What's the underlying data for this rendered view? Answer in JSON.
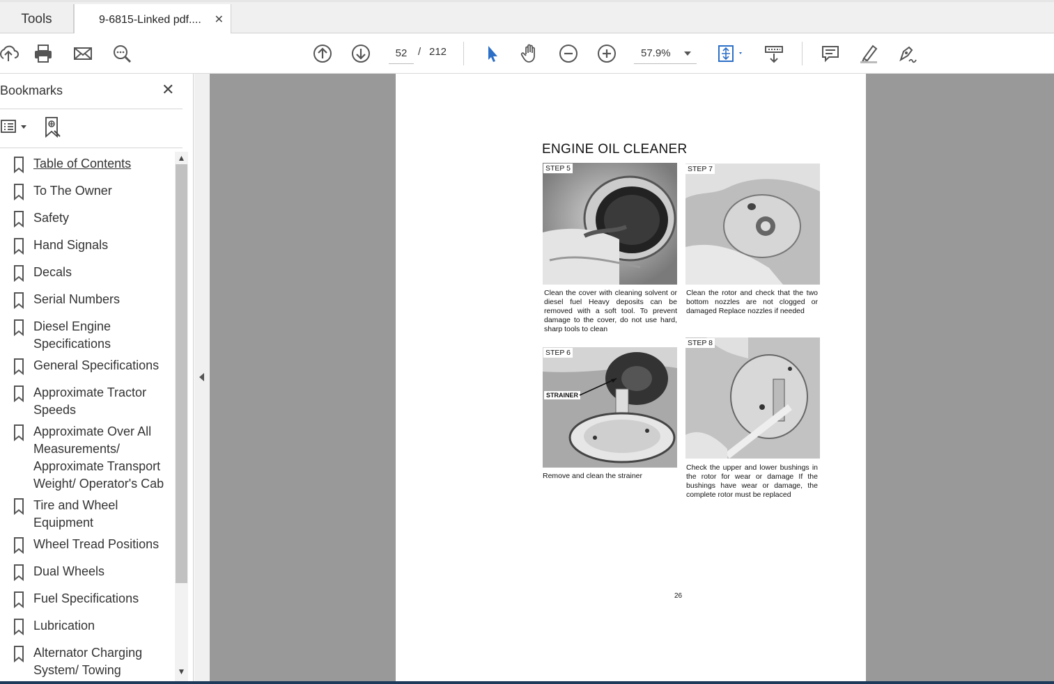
{
  "tabs": {
    "tools_label": "Tools",
    "document_label": "9-6815-Linked pdf....",
    "close_glyph": "✕"
  },
  "toolbar": {
    "icons": [
      "upload-icon",
      "print-icon",
      "email-icon",
      "find-icon",
      "page-up-icon",
      "page-down-icon",
      "select-cursor-icon",
      "hand-tool-icon",
      "zoom-out-icon",
      "zoom-in-icon",
      "fit-page-icon",
      "read-mode-icon",
      "comment-icon",
      "highlight-icon",
      "sign-icon"
    ],
    "current_page": "52",
    "page_separator": "/",
    "total_pages": "212",
    "zoom_value": "57.9%",
    "accent_color": "#2b6fc7"
  },
  "sidebar": {
    "title": "Bookmarks",
    "close_glyph": "✕",
    "scroll_up": "▲",
    "scroll_down": "▼",
    "items": [
      {
        "label": "Table of Contents"
      },
      {
        "label": "To The Owner"
      },
      {
        "label": "Safety"
      },
      {
        "label": "Hand Signals"
      },
      {
        "label": "Decals"
      },
      {
        "label": "Serial Numbers"
      },
      {
        "label": "Diesel Engine Specifications"
      },
      {
        "label": "General Specifications"
      },
      {
        "label": "Approximate Tractor Speeds"
      },
      {
        "label": "Approximate Over All Measurements/ Approximate Transport Weight/ Operator's Cab"
      },
      {
        "label": "Tire and Wheel Equipment"
      },
      {
        "label": "Wheel Tread Positions"
      },
      {
        "label": "Dual Wheels"
      },
      {
        "label": "Fuel Specifications"
      },
      {
        "label": "Lubrication"
      },
      {
        "label": "Alternator Charging System/ Towing"
      }
    ]
  },
  "document": {
    "title": "ENGINE OIL CLEANER",
    "steps": [
      {
        "label": "STEP 5",
        "caption": "Clean the cover with cleaning solvent or diesel fuel Heavy deposits can be removed with a soft tool. To prevent damage to the cover, do not use hard, sharp tools to clean"
      },
      {
        "label": "STEP 7",
        "caption": "Clean the rotor and check that the two bottom nozzles are not clogged or damaged Replace nozzles if needed"
      },
      {
        "label": "STEP 6",
        "caption": "Remove and clean the strainer",
        "callout": "STRAINER"
      },
      {
        "label": "STEP 8",
        "caption": "Check the upper and lower bushings in the rotor for wear or damage If the bushings have wear or damage, the complete rotor must be replaced"
      }
    ],
    "page_number": "26"
  }
}
